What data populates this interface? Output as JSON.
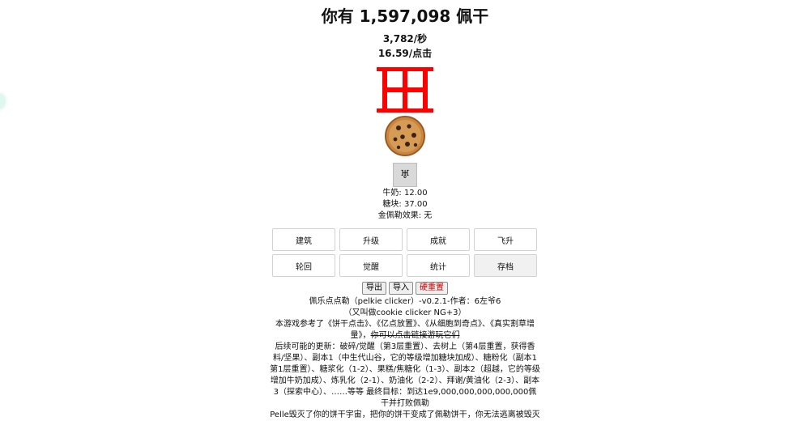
{
  "header": {
    "title": "你有 1,597,098 佩干",
    "per_second": "3,782/秒",
    "per_click": "16.59/点击"
  },
  "special_button": {
    "glyph": "♅"
  },
  "stats": {
    "milk": "牛奶: 12.00",
    "sugar": "糖块: 37.00",
    "golden_effect": "金佩勒效果: 无"
  },
  "tabs": [
    {
      "label": "建筑"
    },
    {
      "label": "升级"
    },
    {
      "label": "成就"
    },
    {
      "label": "飞升"
    },
    {
      "label": "轮回"
    },
    {
      "label": "觉醒"
    },
    {
      "label": "统计"
    },
    {
      "label": "存档"
    }
  ],
  "save_controls": {
    "export_label": "导出",
    "import_label": "导入",
    "hard_reset_label": "硬重置"
  },
  "description": {
    "line1": "佩乐点点勒（pelkie clicker）-v0.2.1-作者：6左爷6",
    "line2": "（又叫做cookie clicker NG+3）",
    "references": "本游戏参考了《饼干点击》、《亿点放置》、《从细胞到奇点》、《真实割草增量》，",
    "strike": "你可以点击链接游玩它们",
    "future": "后续可能的更新：破碎/觉醒（第3层重置）、去树上（第4层重置，获得香料/坚果）、副本1（中生代山谷，它的等级增加糖块加成）、糖粉化（副本1第1层重置）、糖浆化（1-2）、果糕/焦糖化（1-3）、副本2（超越，它的等级增加牛奶加成）、炼乳化（2-1）、奶油化（2-2）、拜谢/黄油化（2-3）、副本3（探索中心）、……等等 最终目标：到达1e9,000,000,000,000,000佩干并打败佩勒",
    "story": "Pelle毁灭了你的饼干宇宙，把你的饼干变成了佩勒饼干，你无法逃离被毁灭"
  },
  "colors": {
    "logo_red": "#ff0000",
    "hard_reset_text": "#d60000"
  }
}
